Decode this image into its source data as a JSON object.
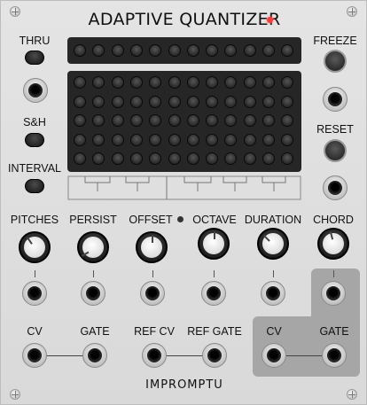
{
  "title": "ADAPTIVE QUANTIZER",
  "brand": "IMPROMPTU",
  "colors": {
    "panel": "#e0e0e0",
    "title_led": "#ff3a3a",
    "matrix": "#262626",
    "shaded_block": "#a6a6a6"
  },
  "left_column": {
    "thru_label": "THRU",
    "sh_label": "S&H",
    "interval_label": "INTERVAL"
  },
  "right_column": {
    "freeze_label": "FREEZE",
    "reset_label": "RESET"
  },
  "knobs": [
    {
      "label": "PITCHES",
      "icon": "knob-icon"
    },
    {
      "label": "PERSIST",
      "icon": "knob-icon"
    },
    {
      "label": "OFFSET",
      "icon": "knob-icon"
    },
    {
      "label": "OCTAVE",
      "icon": "knob-icon"
    },
    {
      "label": "DURATION",
      "icon": "knob-icon"
    },
    {
      "label": "CHORD",
      "icon": "knob-icon"
    }
  ],
  "bottom_inputs": {
    "cv_label": "CV",
    "gate_label": "GATE",
    "ref_cv_label": "REF CV",
    "ref_gate_label": "REF GATE"
  },
  "outputs": {
    "cv_label": "CV",
    "gate_label": "GATE"
  }
}
